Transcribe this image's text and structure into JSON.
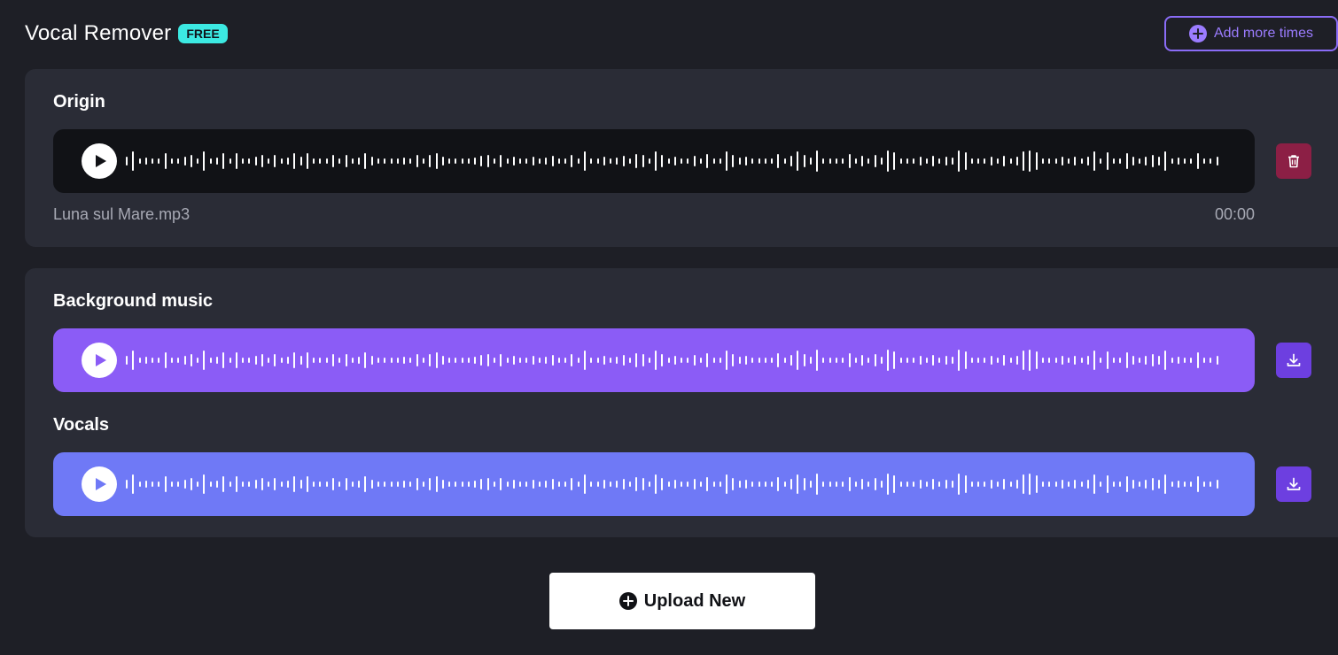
{
  "header": {
    "title": "Vocal Remover",
    "badge": "FREE",
    "add_more_label": "Add more times"
  },
  "origin": {
    "title": "Origin",
    "file_name": "Luna sul Mare.mp3",
    "time": "00:00"
  },
  "results": {
    "background": {
      "title": "Background music"
    },
    "vocals": {
      "title": "Vocals"
    }
  },
  "upload": {
    "label": "Upload New"
  },
  "colors": {
    "page_bg": "#1e1f26",
    "card_bg": "#2a2c36",
    "origin_track": "#111216",
    "background_track": "#8b5cf6",
    "vocals_track": "#6f79f6",
    "free_badge": "#3ce9e2",
    "accent_outline": "#8a6cf6",
    "delete": "#8c1f45",
    "download": "#6d3fe0"
  },
  "icons": {
    "add_more": "plus-circle-icon",
    "play": "play-icon",
    "delete": "trash-icon",
    "download": "download-icon",
    "upload": "plus-circle-icon"
  }
}
